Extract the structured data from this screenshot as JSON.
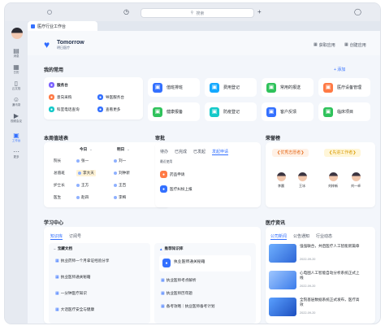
{
  "top": {
    "search_placeholder": "搜索"
  },
  "rail": {
    "items": [
      {
        "label": "消息",
        "icon": "chat-icon"
      },
      {
        "label": "日历",
        "icon": "calendar-icon"
      },
      {
        "label": "云文档",
        "icon": "docs-icon"
      },
      {
        "label": "通讯录",
        "icon": "contacts-icon"
      },
      {
        "label": "视频会议",
        "icon": "video-icon"
      },
      {
        "label": "工作台",
        "icon": "workbench-icon"
      },
      {
        "label": "更多",
        "icon": "more-icon"
      }
    ]
  },
  "tabstrip": {
    "active_tab": "医疗行业工作台"
  },
  "header": {
    "logo_title": "Tomorrow",
    "logo_subtitle": "明日医疗",
    "btn_get_apps": "获取应用",
    "btn_create_apps": "创建应用"
  },
  "my_common": {
    "title": "我的常用",
    "add": "+ 添加",
    "service_desk": {
      "title": "服务台",
      "items": [
        "意向采购",
        "导医服务台",
        "科室电话查询",
        "查看更多"
      ]
    },
    "apps": [
      "值班排班",
      "费用登记",
      "常用的报送",
      "医疗设备管理",
      "健康报备",
      "防疫登记",
      "客户反馈",
      "临床项目"
    ]
  },
  "duty": {
    "title": "本周值班表",
    "today": "今日",
    "tomorrow": "明日",
    "rows": [
      {
        "role": "院长",
        "today": "张一",
        "tomorrow": "刘一"
      },
      {
        "role": "总值班",
        "today": "李大天",
        "tomorrow": "刘钟新"
      },
      {
        "role": "护士长",
        "today": "王方",
        "tomorrow": "王百"
      },
      {
        "role": "医生",
        "today": "赵四",
        "tomorrow": "李梅"
      }
    ]
  },
  "approval": {
    "title": "审批",
    "tabs": [
      "待办",
      "已完成",
      "已发起",
      "发起申请"
    ],
    "recent": "最近使用",
    "items": [
      "药品申请",
      "医疗纠纷上报"
    ]
  },
  "honor": {
    "title": "荣誉榜",
    "badges": [
      "优秀志愿者",
      "先进工作者"
    ],
    "people": [
      "李晨",
      "王冰",
      "刘梓新",
      "刘一卓"
    ]
  },
  "learning": {
    "title": "学习中心",
    "tabs": [
      "知识库",
      "订阅号"
    ],
    "col1_title": "宝藏文档",
    "col1_items": [
      "执业药师一个月拿证经验分享",
      "执业医师通关秘籍",
      "一分钟医疗知识",
      "大话医疗安全与健康"
    ],
    "col1_metas": [
      "",
      "",
      "",
      ""
    ],
    "col2_title": "推荐知识库",
    "col2_card_title": "执业医师通关秘籍",
    "col2_card_sub": "",
    "col2_items": [
      "执业医师考点解析",
      "执业医师历年题",
      "备考攻略｜执业医师备考计划"
    ]
  },
  "news": {
    "title": "医疗资讯",
    "tabs": [
      "公司新闻",
      "公告通知",
      "行业动态"
    ],
    "items": [
      {
        "title": "强强联合，共启医疗人工智能新篇章",
        "date": "2022-09-20"
      },
      {
        "title": "心电图人工智能自动分析系统正式上线",
        "date": "2022-09-20"
      },
      {
        "title": "全院基层数据系统正式发布，医疗高效",
        "date": "2022-09-20"
      }
    ]
  },
  "colors": {
    "accent": "#3370ff",
    "bg": "#f3f6fb"
  }
}
